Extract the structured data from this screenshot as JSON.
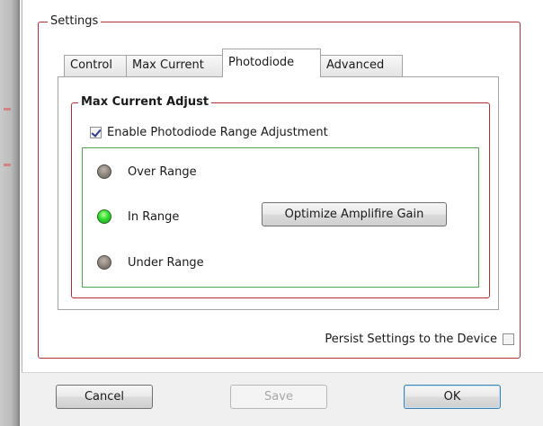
{
  "settings_group": {
    "title": "Settings"
  },
  "tabs": [
    {
      "label": "Control",
      "selected": false
    },
    {
      "label": "Max Current",
      "selected": false
    },
    {
      "label": "Photodiode",
      "selected": true
    },
    {
      "label": "Advanced",
      "selected": false
    }
  ],
  "max_current_adjust": {
    "title": "Max Current Adjust",
    "enable_checkbox": {
      "label": "Enable Photodiode Range Adjustment",
      "checked": true
    },
    "indicators": [
      {
        "label": "Over Range",
        "state": "off",
        "color": "#8b8178"
      },
      {
        "label": "In Range",
        "state": "on",
        "color": "#2fdc2f"
      },
      {
        "label": "Under Range",
        "state": "off",
        "color": "#8b8178"
      }
    ],
    "optimize_button": {
      "label": "Optimize Amplifire Gain"
    }
  },
  "persist": {
    "label": "Persist Settings to the Device",
    "checked": false
  },
  "footer": {
    "cancel_label": "Cancel",
    "save_label": "Save",
    "save_enabled": false,
    "ok_label": "OK"
  },
  "colors": {
    "group_border": "#b03036",
    "status_border": "#4aa850",
    "default_button_border": "#3c7fb1"
  }
}
